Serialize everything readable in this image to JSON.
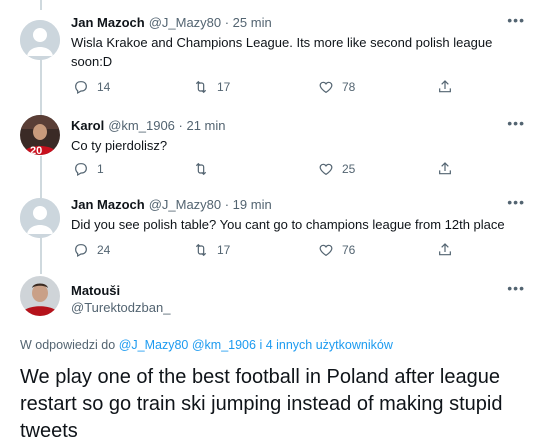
{
  "tweets": [
    {
      "name": "Jan Mazoch",
      "meta": "@J_Mazy80 · 25 min",
      "text": "Wisla Krakoe and Champions League. Its more like second polish league soon:D",
      "reply_count": "14",
      "retweet_count": "17",
      "like_count": "78",
      "avatar": "default-avatar"
    },
    {
      "name": "Karol",
      "meta": "@km_1906 · 21 min",
      "text": "Co ty pierdolisz?",
      "reply_count": "1",
      "retweet_count": "",
      "like_count": "25",
      "avatar": "player-photo-avatar",
      "avatar_jersey_number": "20"
    },
    {
      "name": "Jan Mazoch",
      "meta": "@J_Mazy80 · 19 min",
      "text": "Did you see polish table? You cant go to champions league from 12th place",
      "reply_count": "24",
      "retweet_count": "17",
      "like_count": "76",
      "avatar": "default-avatar"
    }
  ],
  "main_tweet": {
    "name": "Matouši",
    "handle": "@Turektodzban_",
    "avatar": "player-photo-avatar",
    "replying_prefix": "W odpowiedzi do",
    "replying_user1": "@J_Mazy80",
    "replying_user2": "@km_1906",
    "replying_others": "i 4 innych użytkowników",
    "text": "We play one of the best football in Poland after league restart so go train ski jumping instead of making stupid tweets"
  },
  "colors": {
    "link": "#1d9bf0",
    "secondary_text": "#536471",
    "thread_line": "#cfd9de"
  },
  "icons": [
    "reply-icon",
    "retweet-icon",
    "like-icon",
    "share-icon",
    "more-icon"
  ]
}
